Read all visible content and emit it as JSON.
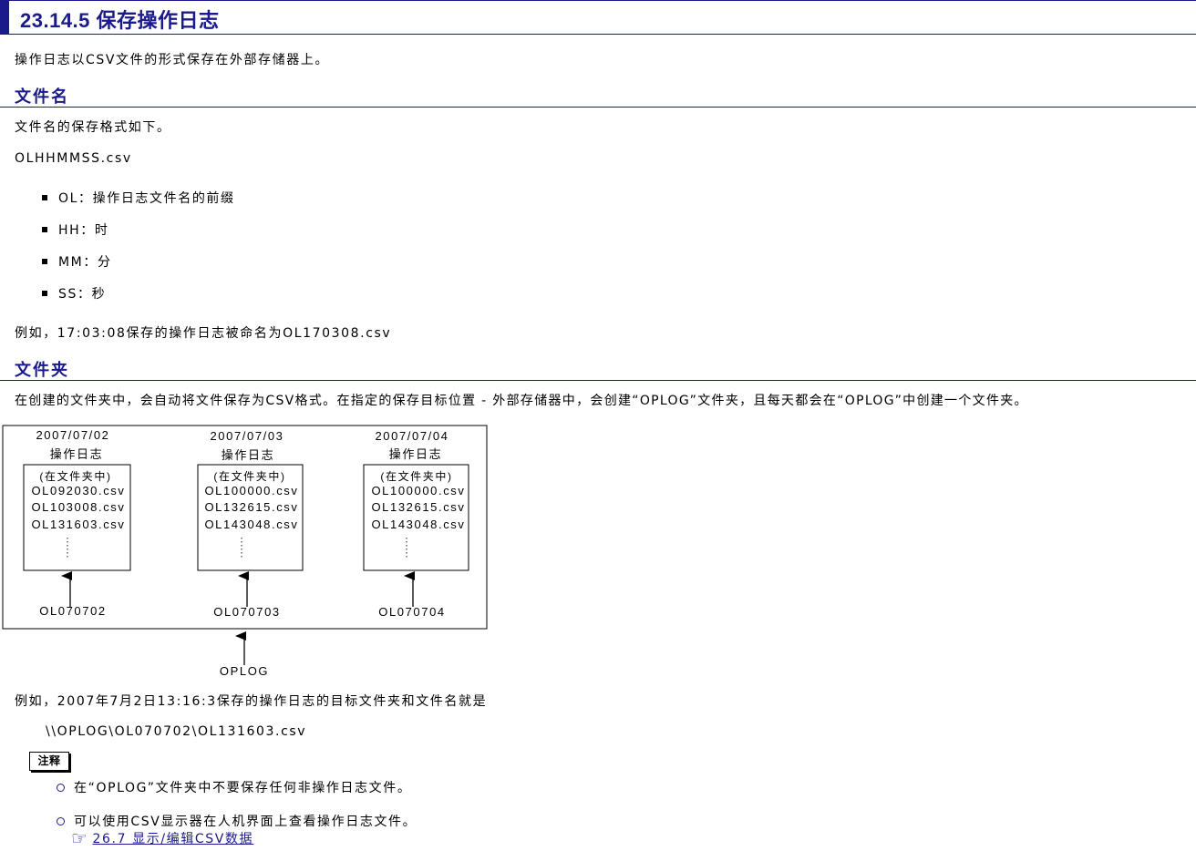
{
  "title": "23.14.5 保存操作日志",
  "intro": "操作日志以CSV文件的形式保存在外部存储器上。",
  "section_filename": {
    "heading": "文件名",
    "desc": "文件名的保存格式如下。",
    "format": "OLHHMMSS.csv",
    "bullets": [
      "OL：操作日志文件名的前缀",
      "HH：时",
      "MM：分",
      "SS：秒"
    ],
    "example": "例如，17:03:08保存的操作日志被命名为OL170308.csv"
  },
  "section_folder": {
    "heading": "文件夹",
    "desc": "在创建的文件夹中，会自动将文件保存为CSV格式。在指定的保存目标位置 - 外部存储器中，会创建“OPLOG”文件夹，且每天都会在“OPLOG”中创建一个文件夹。"
  },
  "diagram": {
    "folders": [
      {
        "date": "2007/07/02",
        "label": "操作日志",
        "inside": "(在文件夹中)",
        "files": [
          "OL092030.csv",
          "OL103008.csv",
          "OL131603.csv"
        ],
        "name": "OL070702"
      },
      {
        "date": "2007/07/03",
        "label": "操作日志",
        "inside": "(在文件夹中)",
        "files": [
          "OL100000.csv",
          "OL132615.csv",
          "OL143048.csv"
        ],
        "name": "OL070703"
      },
      {
        "date": "2007/07/04",
        "label": "操作日志",
        "inside": "(在文件夹中)",
        "files": [
          "OL100000.csv",
          "OL132615.csv",
          "OL143048.csv"
        ],
        "name": "OL070704"
      }
    ],
    "root": "OPLOG"
  },
  "example2": "例如，2007年7月2日13:16:3保存的操作日志的目标文件夹和文件名就是",
  "example2_path": "\\\\OPLOG\\OL070702\\OL131603.csv",
  "note": {
    "tag": "注释",
    "items": [
      "在“OPLOG”文件夹中不要保存任何非操作日志文件。",
      "可以使用CSV显示器在人机界面上查看操作日志文件。"
    ],
    "link_icon": "pointing-hand-icon",
    "link": "26.7 显示/编辑CSV数据"
  }
}
